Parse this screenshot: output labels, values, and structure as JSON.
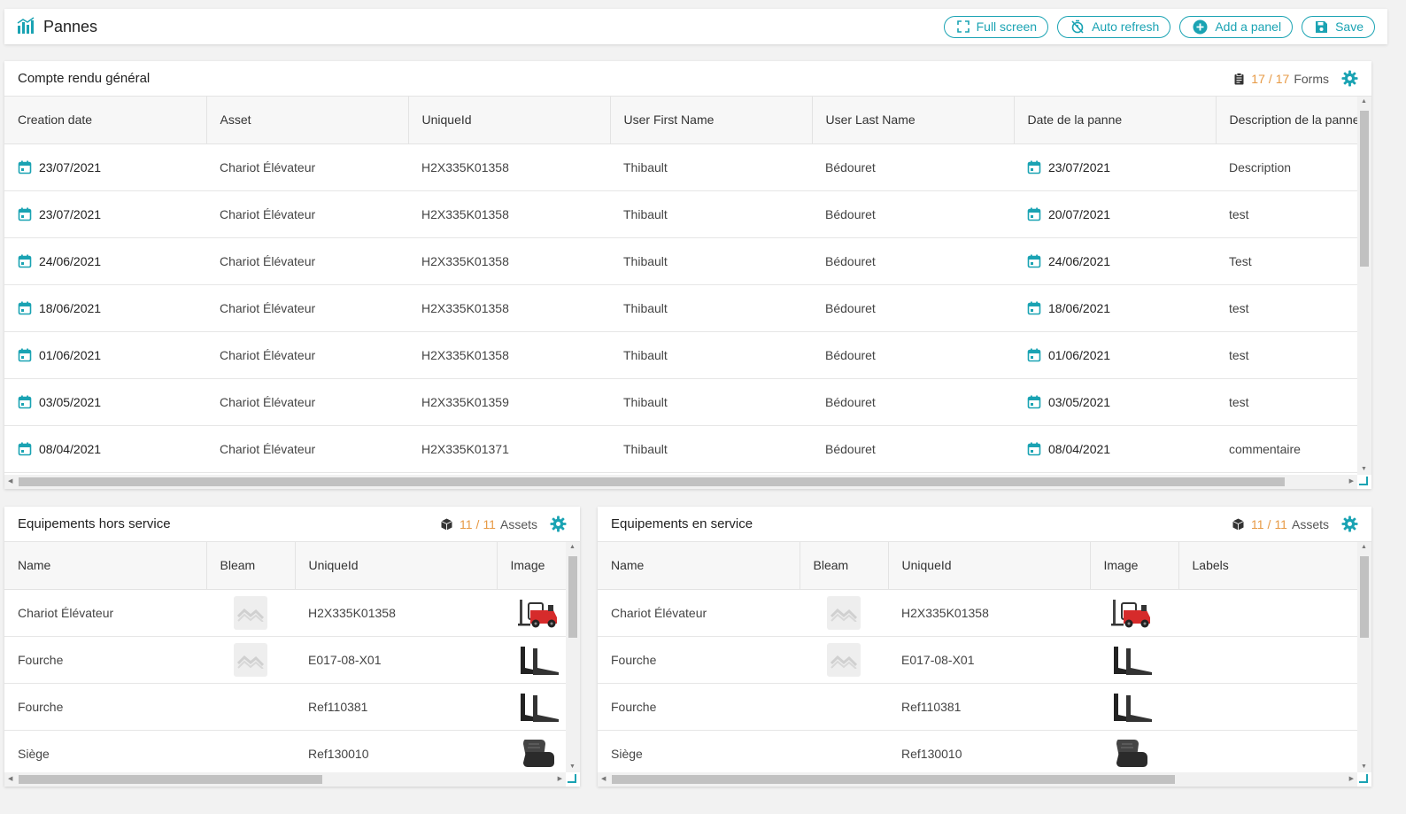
{
  "header": {
    "title": "Pannes",
    "buttons": {
      "fullscreen": "Full screen",
      "autorefresh": "Auto refresh",
      "addpanel": "Add a panel",
      "save": "Save"
    }
  },
  "colors": {
    "accent": "#1aa3b3",
    "count": "#e79a45"
  },
  "panel_forms": {
    "title": "Compte rendu général",
    "count_current": "17",
    "count_total": "17",
    "count_unit": "Forms",
    "columns": [
      "Creation date",
      "Asset",
      "UniqueId",
      "User First Name",
      "User Last Name",
      "Date de la panne",
      "Description de la panne"
    ],
    "rows": [
      {
        "created": "23/07/2021",
        "asset": "Chariot Élévateur",
        "uid": "H2X335K01358",
        "first": "Thibault",
        "last": "Bédouret",
        "panne": "23/07/2021",
        "desc": "Description"
      },
      {
        "created": "23/07/2021",
        "asset": "Chariot Élévateur",
        "uid": "H2X335K01358",
        "first": "Thibault",
        "last": "Bédouret",
        "panne": "20/07/2021",
        "desc": "test"
      },
      {
        "created": "24/06/2021",
        "asset": "Chariot Élévateur",
        "uid": "H2X335K01358",
        "first": "Thibault",
        "last": "Bédouret",
        "panne": "24/06/2021",
        "desc": "Test"
      },
      {
        "created": "18/06/2021",
        "asset": "Chariot Élévateur",
        "uid": "H2X335K01358",
        "first": "Thibault",
        "last": "Bédouret",
        "panne": "18/06/2021",
        "desc": "test"
      },
      {
        "created": "01/06/2021",
        "asset": "Chariot Élévateur",
        "uid": "H2X335K01358",
        "first": "Thibault",
        "last": "Bédouret",
        "panne": "01/06/2021",
        "desc": "test"
      },
      {
        "created": "03/05/2021",
        "asset": "Chariot Élévateur",
        "uid": "H2X335K01359",
        "first": "Thibault",
        "last": "Bédouret",
        "panne": "03/05/2021",
        "desc": "test"
      },
      {
        "created": "08/04/2021",
        "asset": "Chariot Élévateur",
        "uid": "H2X335K01371",
        "first": "Thibault",
        "last": "Bédouret",
        "panne": "08/04/2021",
        "desc": "commentaire"
      }
    ]
  },
  "panel_hors": {
    "title": "Equipements hors service",
    "count_current": "11",
    "count_total": "11",
    "count_unit": "Assets",
    "columns": [
      "Name",
      "Bleam",
      "UniqueId",
      "Image"
    ],
    "rows": [
      {
        "name": "Chariot Élévateur",
        "bleam": true,
        "uid": "H2X335K01358",
        "image": "forklift-icon"
      },
      {
        "name": "Fourche",
        "bleam": true,
        "uid": "E017-08-X01",
        "image": "fork-icon"
      },
      {
        "name": "Fourche",
        "bleam": false,
        "uid": "Ref110381",
        "image": "fork-icon"
      },
      {
        "name": "Siège",
        "bleam": false,
        "uid": "Ref130010",
        "image": "seat-icon"
      }
    ]
  },
  "panel_en": {
    "title": "Equipements en service",
    "count_current": "11",
    "count_total": "11",
    "count_unit": "Assets",
    "columns": [
      "Name",
      "Bleam",
      "UniqueId",
      "Image",
      "Labels"
    ],
    "rows": [
      {
        "name": "Chariot Élévateur",
        "bleam": true,
        "uid": "H2X335K01358",
        "image": "forklift-icon"
      },
      {
        "name": "Fourche",
        "bleam": true,
        "uid": "E017-08-X01",
        "image": "fork-icon"
      },
      {
        "name": "Fourche",
        "bleam": false,
        "uid": "Ref110381",
        "image": "fork-icon"
      },
      {
        "name": "Siège",
        "bleam": false,
        "uid": "Ref130010",
        "image": "seat-icon"
      }
    ]
  }
}
